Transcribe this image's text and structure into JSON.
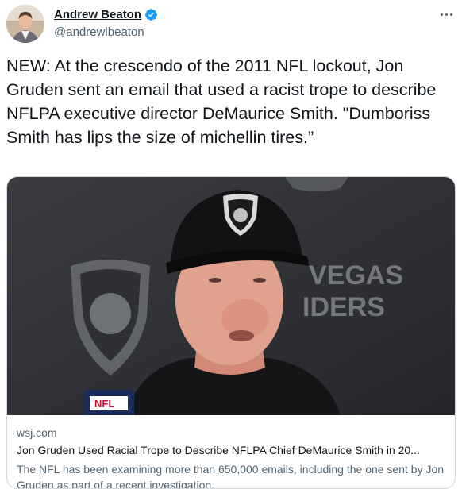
{
  "author": {
    "display_name": "Andrew Beaton",
    "handle": "@andrewlbeaton",
    "verified": true,
    "avatar_icon": "profile-photo"
  },
  "menu": {
    "icon": "more-options-icon"
  },
  "tweet": {
    "text": "NEW: At the crescendo of the 2011 NFL lockout, Jon Gruden sent an email that used a racist trope to describe NFLPA executive director DeMaurice Smith. \"Dumboriss Smith has lips the size of michellin tires.”"
  },
  "card": {
    "domain": "wsj.com",
    "headline": "Jon Gruden Used Racial Trope to Describe NFLPA Chief DeMaurice Smith in 20...",
    "description": "The NFL has been examining more than 650,000 emails, including the one sent by Jon Gruden as part of a recent investigation.",
    "image_icon": "article-photo"
  },
  "colors": {
    "text": "#0f1419",
    "secondary": "#536471",
    "verified": "#1d9bf0",
    "border": "#cfd9de"
  }
}
